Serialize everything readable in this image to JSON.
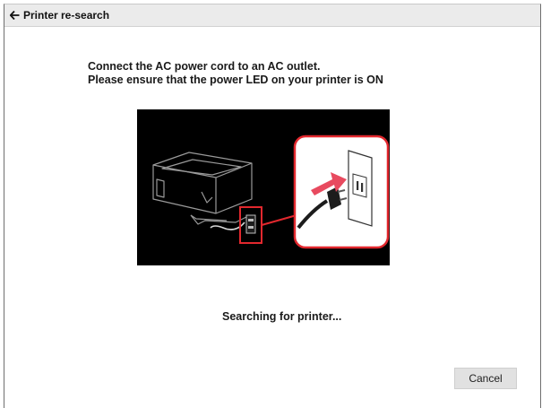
{
  "window": {
    "title": "Printer re-search"
  },
  "instructions": {
    "line1": "Connect the AC power cord to an AC outlet.",
    "line2": "Please ensure that the power LED on your printer is ON"
  },
  "illustration": {
    "icon": "printer-power-cord-icon",
    "highlight_color": "#e2282e",
    "arrow_color": "#e84a5f"
  },
  "status": {
    "text": "Searching for printer..."
  },
  "buttons": {
    "cancel_label": "Cancel"
  },
  "colors": {
    "titlebar_bg": "#ebebeb",
    "button_bg": "#e1e1e1"
  }
}
